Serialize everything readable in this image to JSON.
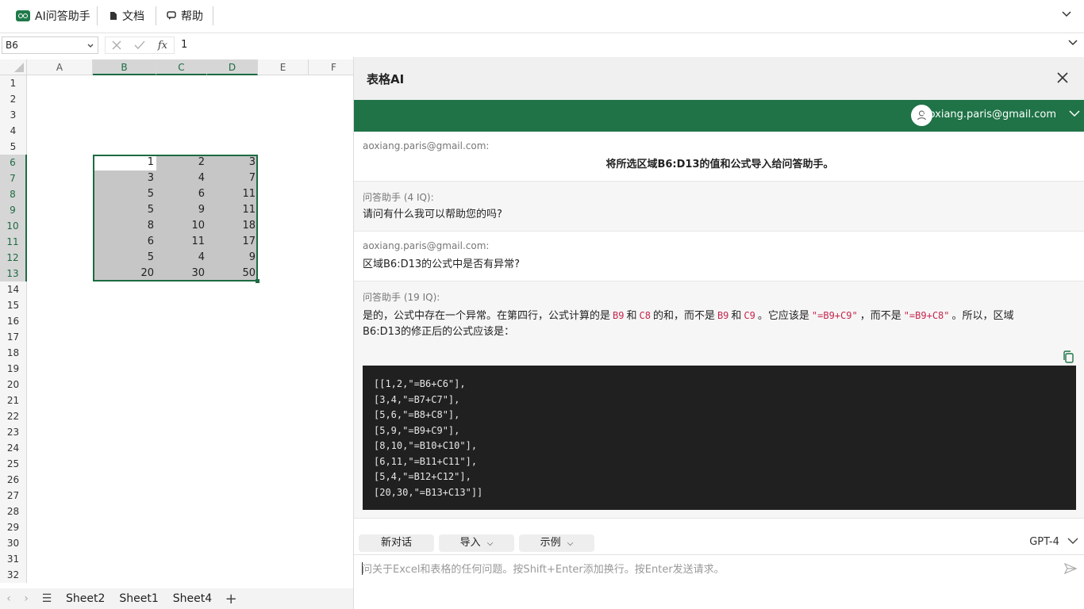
{
  "ribbon": {
    "ai_assistant": "AI问答助手",
    "docs": "文档",
    "help": "帮助"
  },
  "formula_bar": {
    "name_box": "B6",
    "formula_value": "1"
  },
  "sheet": {
    "columns": [
      "A",
      "B",
      "C",
      "D",
      "E",
      "F"
    ],
    "rows": [
      "1",
      "2",
      "3",
      "4",
      "5",
      "6",
      "7",
      "8",
      "9",
      "10",
      "11",
      "12",
      "13",
      "14",
      "15",
      "16",
      "17",
      "18",
      "19",
      "20",
      "21",
      "22",
      "23",
      "24",
      "25",
      "26",
      "27",
      "28",
      "29",
      "30",
      "31",
      "32"
    ],
    "cells": {
      "B": [
        "1",
        "3",
        "5",
        "5",
        "8",
        "6",
        "5",
        "20"
      ],
      "C": [
        "2",
        "4",
        "6",
        "9",
        "10",
        "11",
        "4",
        "30"
      ],
      "D": [
        "3",
        "7",
        "11",
        "11",
        "18",
        "17",
        "9",
        "50"
      ]
    }
  },
  "tabs": [
    "Sheet2",
    "Sheet1",
    "Sheet4"
  ],
  "panel": {
    "title": "表格AI",
    "account": "aoxiang.paris@gmail.com",
    "messages": {
      "m1_sender": "aoxiang.paris@gmail.com:",
      "m1_text": "将所选区域B6:D13的值和公式导入给问答助手。",
      "m2_sender": "问答助手 (4 IQ):",
      "m2_text": "请问有什么我可以帮助您的吗?",
      "m3_sender": "aoxiang.paris@gmail.com:",
      "m3_text": "区域B6:D13的公式中是否有异常?",
      "m4_sender": "问答助手 (19 IQ):",
      "m4_p1": "是的，公式中存在一个异常。在第四行，公式计算的是",
      "m4_c1": "B9",
      "m4_p2": "和",
      "m4_c2": "C8",
      "m4_p3": "的和，而不是",
      "m4_c3": "B9",
      "m4_p4": "和",
      "m4_c4": "C9",
      "m4_p5": "。它应该是",
      "m4_c5": "\"=B9+C9\"",
      "m4_p6": "，而不是",
      "m4_c6": "\"=B9+C8\"",
      "m4_p7": "。所以，区域",
      "m4_line2": "B6:D13的修正后的公式应该是：",
      "m4_code": "[[1,2,\"=B6+C6\"],\n[3,4,\"=B7+C7\"],\n[5,6,\"=B8+C8\"],\n[5,9,\"=B9+C9\"],\n[8,10,\"=B10+C10\"],\n[6,11,\"=B11+C11\"],\n[5,4,\"=B12+C12\"],\n[20,30,\"=B13+C13\"]]"
    },
    "actions": {
      "new_chat": "新对话",
      "import": "导入",
      "examples": "示例",
      "model": "GPT-4"
    },
    "input_placeholder": "问关于Excel和表格的任何问题。按Shift+Enter添加换行。按Enter发送请求。"
  }
}
